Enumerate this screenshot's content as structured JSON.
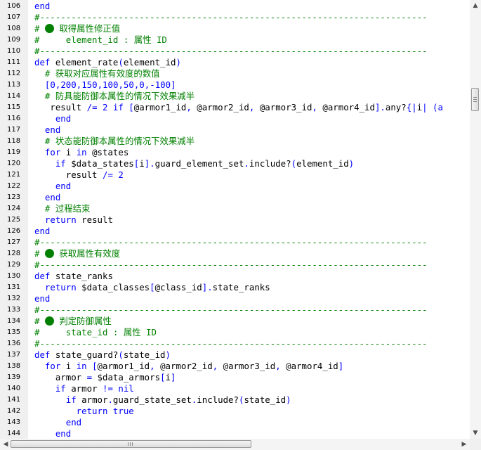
{
  "editor": {
    "colors": {
      "keyword": "#0000ff",
      "comment": "#008000",
      "number": "#0000ff",
      "text": "#000000",
      "gutter": "#f0f0f0"
    },
    "lines": [
      {
        "n": "106",
        "t": [
          [
            "kw",
            "end"
          ]
        ]
      },
      {
        "n": "107",
        "t": [
          [
            "cm",
            "#--------------------------------------------------------------------------"
          ]
        ]
      },
      {
        "n": "108",
        "t": [
          [
            "cm",
            "# "
          ],
          [
            "dot",
            ""
          ],
          [
            "cm",
            " 取得属性修正值"
          ]
        ]
      },
      {
        "n": "109",
        "t": [
          [
            "cm",
            "#     element_id : 属性 ID"
          ]
        ]
      },
      {
        "n": "110",
        "t": [
          [
            "cm",
            "#--------------------------------------------------------------------------"
          ]
        ]
      },
      {
        "n": "111",
        "t": [
          [
            "kw",
            "def"
          ],
          [
            "id",
            " element_rate"
          ],
          [
            "op",
            "("
          ],
          [
            "id",
            "element_id"
          ],
          [
            "op",
            ")"
          ]
        ]
      },
      {
        "n": "112",
        "t": [
          [
            "cm",
            "  # 获取对应属性有效度的数值"
          ]
        ]
      },
      {
        "n": "113",
        "t": [
          [
            "op",
            "  ["
          ],
          [
            "num",
            "0"
          ],
          [
            "op",
            ","
          ],
          [
            "num",
            "200"
          ],
          [
            "op",
            ","
          ],
          [
            "num",
            "150"
          ],
          [
            "op",
            ","
          ],
          [
            "num",
            "100"
          ],
          [
            "op",
            ","
          ],
          [
            "num",
            "50"
          ],
          [
            "op",
            ","
          ],
          [
            "num",
            "0"
          ],
          [
            "op",
            ","
          ],
          [
            "num",
            "-100"
          ],
          [
            "op",
            "]"
          ]
        ]
      },
      {
        "n": "114",
        "t": [
          [
            "cm",
            "  # 防具能防御本属性的情况下效果减半"
          ]
        ]
      },
      {
        "n": "115",
        "t": [
          [
            "id",
            "   result "
          ],
          [
            "op",
            "/="
          ],
          [
            "num",
            " 2 "
          ],
          [
            "kw",
            "if"
          ],
          [
            "op",
            " ["
          ],
          [
            "id",
            "@armor1_id"
          ],
          [
            "op",
            ", "
          ],
          [
            "id",
            "@armor2_id"
          ],
          [
            "op",
            ", "
          ],
          [
            "id",
            "@armor3_id"
          ],
          [
            "op",
            ", "
          ],
          [
            "id",
            "@armor4_id"
          ],
          [
            "op",
            "]."
          ],
          [
            "id",
            "any?"
          ],
          [
            "op",
            "{|"
          ],
          [
            "id",
            "i"
          ],
          [
            "op",
            "| (a"
          ]
        ]
      },
      {
        "n": "116",
        "t": [
          [
            "kw",
            "    end"
          ]
        ]
      },
      {
        "n": "117",
        "t": [
          [
            "kw",
            "  end"
          ]
        ]
      },
      {
        "n": "118",
        "t": [
          [
            "cm",
            "  # 状态能防御本属性的情况下效果减半"
          ]
        ]
      },
      {
        "n": "119",
        "t": [
          [
            "kw",
            "  for"
          ],
          [
            "id",
            " i "
          ],
          [
            "kw",
            "in"
          ],
          [
            "id",
            " @states"
          ]
        ]
      },
      {
        "n": "120",
        "t": [
          [
            "kw",
            "    if"
          ],
          [
            "id",
            " $data_states"
          ],
          [
            "op",
            "["
          ],
          [
            "id",
            "i"
          ],
          [
            "op",
            "]."
          ],
          [
            "id",
            "guard_element_set"
          ],
          [
            "op",
            "."
          ],
          [
            "id",
            "include?"
          ],
          [
            "op",
            "("
          ],
          [
            "id",
            "element_id"
          ],
          [
            "op",
            ")"
          ]
        ]
      },
      {
        "n": "121",
        "t": [
          [
            "id",
            "      result "
          ],
          [
            "op",
            "/="
          ],
          [
            "num",
            " 2"
          ]
        ]
      },
      {
        "n": "122",
        "t": [
          [
            "kw",
            "    end"
          ]
        ]
      },
      {
        "n": "123",
        "t": [
          [
            "kw",
            "  end"
          ]
        ]
      },
      {
        "n": "124",
        "t": [
          [
            "cm",
            "  # 过程结束"
          ]
        ]
      },
      {
        "n": "125",
        "t": [
          [
            "kw",
            "  return"
          ],
          [
            "id",
            " result"
          ]
        ]
      },
      {
        "n": "126",
        "t": [
          [
            "kw",
            "end"
          ]
        ]
      },
      {
        "n": "127",
        "t": [
          [
            "cm",
            "#--------------------------------------------------------------------------"
          ]
        ]
      },
      {
        "n": "128",
        "t": [
          [
            "cm",
            "# "
          ],
          [
            "dot",
            ""
          ],
          [
            "cm",
            " 获取属性有效度"
          ]
        ]
      },
      {
        "n": "129",
        "t": [
          [
            "cm",
            "#--------------------------------------------------------------------------"
          ]
        ]
      },
      {
        "n": "130",
        "t": [
          [
            "kw",
            "def"
          ],
          [
            "id",
            " state_ranks"
          ]
        ]
      },
      {
        "n": "131",
        "t": [
          [
            "kw",
            "  return"
          ],
          [
            "id",
            " $data_classes"
          ],
          [
            "op",
            "["
          ],
          [
            "id",
            "@class_id"
          ],
          [
            "op",
            "]."
          ],
          [
            "id",
            "state_ranks"
          ]
        ]
      },
      {
        "n": "132",
        "t": [
          [
            "kw",
            "end"
          ]
        ]
      },
      {
        "n": "133",
        "t": [
          [
            "cm",
            "#--------------------------------------------------------------------------"
          ]
        ]
      },
      {
        "n": "134",
        "t": [
          [
            "cm",
            "# "
          ],
          [
            "dot",
            ""
          ],
          [
            "cm",
            " 判定防御属性"
          ]
        ]
      },
      {
        "n": "135",
        "t": [
          [
            "cm",
            "#     state_id : 属性 ID"
          ]
        ]
      },
      {
        "n": "136",
        "t": [
          [
            "cm",
            "#--------------------------------------------------------------------------"
          ]
        ]
      },
      {
        "n": "137",
        "t": [
          [
            "kw",
            "def"
          ],
          [
            "id",
            " state_guard?"
          ],
          [
            "op",
            "("
          ],
          [
            "id",
            "state_id"
          ],
          [
            "op",
            ")"
          ]
        ]
      },
      {
        "n": "138",
        "t": [
          [
            "kw",
            "  for"
          ],
          [
            "id",
            " i "
          ],
          [
            "kw",
            "in"
          ],
          [
            "op",
            " ["
          ],
          [
            "id",
            "@armor1_id"
          ],
          [
            "op",
            ", "
          ],
          [
            "id",
            "@armor2_id"
          ],
          [
            "op",
            ", "
          ],
          [
            "id",
            "@armor3_id"
          ],
          [
            "op",
            ", "
          ],
          [
            "id",
            "@armor4_id"
          ],
          [
            "op",
            "]"
          ]
        ]
      },
      {
        "n": "139",
        "t": [
          [
            "id",
            "    armor "
          ],
          [
            "op",
            "="
          ],
          [
            "id",
            " $data_armors"
          ],
          [
            "op",
            "["
          ],
          [
            "id",
            "i"
          ],
          [
            "op",
            "]"
          ]
        ]
      },
      {
        "n": "140",
        "t": [
          [
            "kw",
            "    if"
          ],
          [
            "id",
            " armor "
          ],
          [
            "op",
            "!="
          ],
          [
            "kw",
            " nil"
          ]
        ]
      },
      {
        "n": "141",
        "t": [
          [
            "kw",
            "      if"
          ],
          [
            "id",
            " armor"
          ],
          [
            "op",
            "."
          ],
          [
            "id",
            "guard_state_set"
          ],
          [
            "op",
            "."
          ],
          [
            "id",
            "include?"
          ],
          [
            "op",
            "("
          ],
          [
            "id",
            "state_id"
          ],
          [
            "op",
            ")"
          ]
        ]
      },
      {
        "n": "142",
        "t": [
          [
            "kw",
            "        return true"
          ]
        ]
      },
      {
        "n": "143",
        "t": [
          [
            "kw",
            "      end"
          ]
        ]
      },
      {
        "n": "144",
        "t": [
          [
            "kw",
            "    end"
          ]
        ]
      }
    ]
  },
  "scrollbars": {
    "up_icon": "▲",
    "down_icon": "▼",
    "left_icon": "◀",
    "right_icon": "▶"
  }
}
